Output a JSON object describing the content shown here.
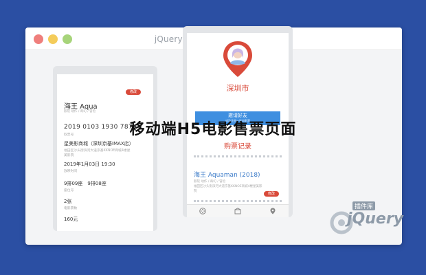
{
  "window": {
    "title": "jQuery插件库-www.jq22.com"
  },
  "headline": "移动端H5电影售票页面",
  "left_phone": {
    "badge_label": "修改",
    "movie_title": "海王 Aqua",
    "meta_line": "影院 动作 / 奇幻 / 冒险",
    "order_number": "2019 0103 1930 7875",
    "order_number_label": "取票号",
    "cinema_name": "星美影商城（深圳京基IMAX店）",
    "cinema_address": "福田区沙头街滨河大道京基KKNOE商城4楼星",
    "cinema_address2": "美影院",
    "datetime": "2019年1月03日 19:30",
    "datetime_label": "放映时间",
    "seats": "9排09座　9排08座",
    "seats_label": "座位号",
    "price_unit": "2张",
    "price_unit_label": "电影票数",
    "total": "160元"
  },
  "right_phone": {
    "city": "深圳市",
    "invite_label": "邀请好友",
    "invite_sub": "成功注册一张电影票",
    "records_title": "购票记录",
    "movie_title": "海王 Aquaman (2018)",
    "meta_line": "影院 动作 / 奇幻 / 冒险",
    "address_line": "福田区沙头街滨河大道京基KKNOE商城4楼星美影",
    "address_line2": "院",
    "badge_label": "修改"
  },
  "watermark": {
    "text": "jQuery",
    "label": "插件库"
  },
  "colors": {
    "background": "#2b4fa3",
    "accent_red": "#d94a3a",
    "accent_blue": "#3f8fe0",
    "title_blue": "#3778c7"
  }
}
